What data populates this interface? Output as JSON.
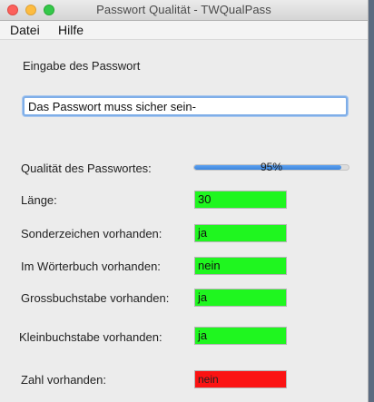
{
  "window": {
    "title": "Passwort Qualität - TWQualPass"
  },
  "menu": {
    "items": [
      "Datei",
      "Hilfe"
    ]
  },
  "form": {
    "input_label": "Eingabe des Passwort",
    "input_value": "Das Passwort muss sicher sein-",
    "quality_label": "Qualität des Passwortes:",
    "quality_percent": 95,
    "quality_text": "95%"
  },
  "results": [
    {
      "label": "Länge:",
      "value": "30",
      "status": "ok"
    },
    {
      "label": "Sonderzeichen vorhanden:",
      "value": "ja",
      "status": "ok"
    },
    {
      "label": "Im Wörterbuch vorhanden:",
      "value": "nein",
      "status": "ok"
    },
    {
      "label": "Grossbuchstabe vorhanden:",
      "value": "ja",
      "status": "ok"
    },
    {
      "label": "Kleinbuchstabe vorhanden:",
      "value": "ja",
      "status": "ok"
    },
    {
      "label": "Zahl vorhanden:",
      "value": "nein",
      "status": "bad"
    }
  ],
  "colors": {
    "ok": "#1ff61f",
    "bad": "#fb1313",
    "progress": "#3c85dc"
  }
}
